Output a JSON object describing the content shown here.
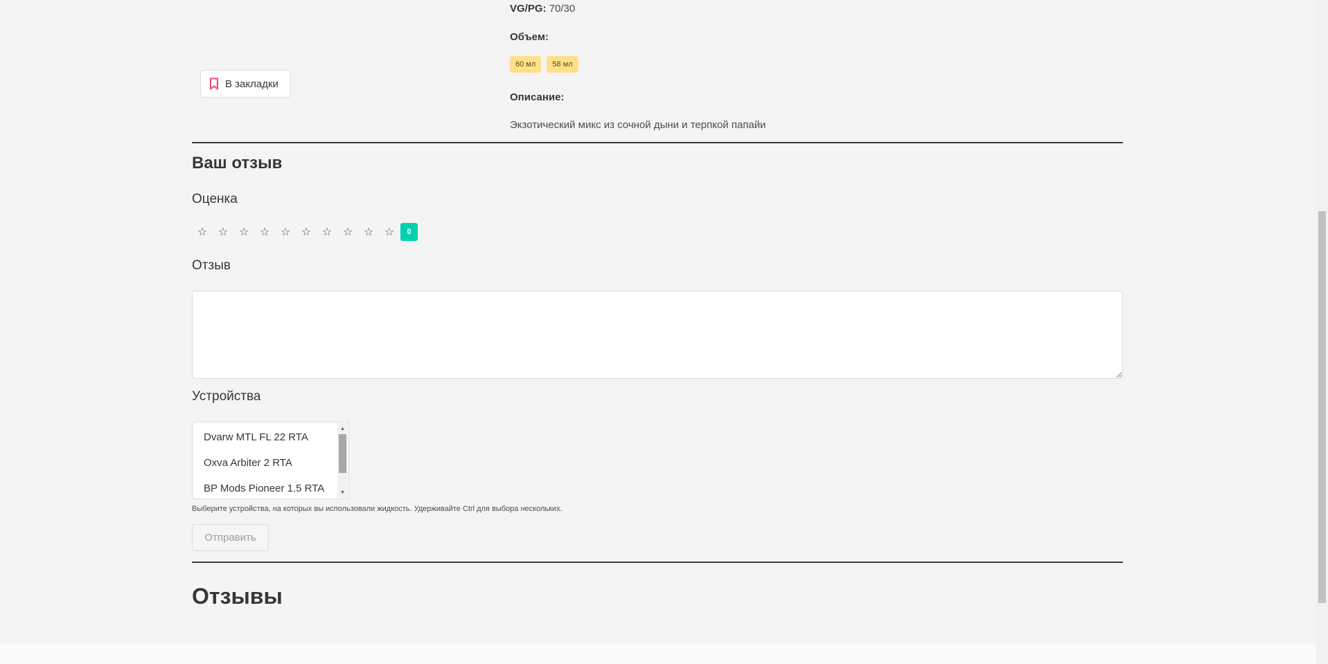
{
  "product": {
    "bookmark_label": "В закладки",
    "bookmark_icon": "bookmark-icon",
    "vgpg_label": "VG/PG:",
    "vgpg_value": "70/30",
    "volume_label": "Объем:",
    "volumes": [
      "60 мл",
      "58 мл"
    ],
    "description_label": "Описание:",
    "description": "Экзотический микс из сочной дыни и терпкой папайи"
  },
  "review_form": {
    "title": "Ваш отзыв",
    "rating_label": "Оценка",
    "star_glyph": "☆",
    "star_count": 10,
    "rating_value": "0",
    "review_label": "Отзыв",
    "review_text": "",
    "devices_label": "Устройства",
    "devices": [
      "Dvarw MTL FL 22 RTA",
      "Oxva Arbiter 2 RTA",
      "BP Mods Pioneer 1.5 RTA"
    ],
    "devices_help": "Выберите устройства, на которых вы использовали жидкость. Удерживайте Ctrl для выбора нескольких.",
    "submit_label": "Отправить"
  },
  "reviews": {
    "title": "Отзывы"
  },
  "colors": {
    "accent_teal": "#00d1b2",
    "tag_yellow": "#ffe08a",
    "bookmark_red": "#f14668"
  }
}
